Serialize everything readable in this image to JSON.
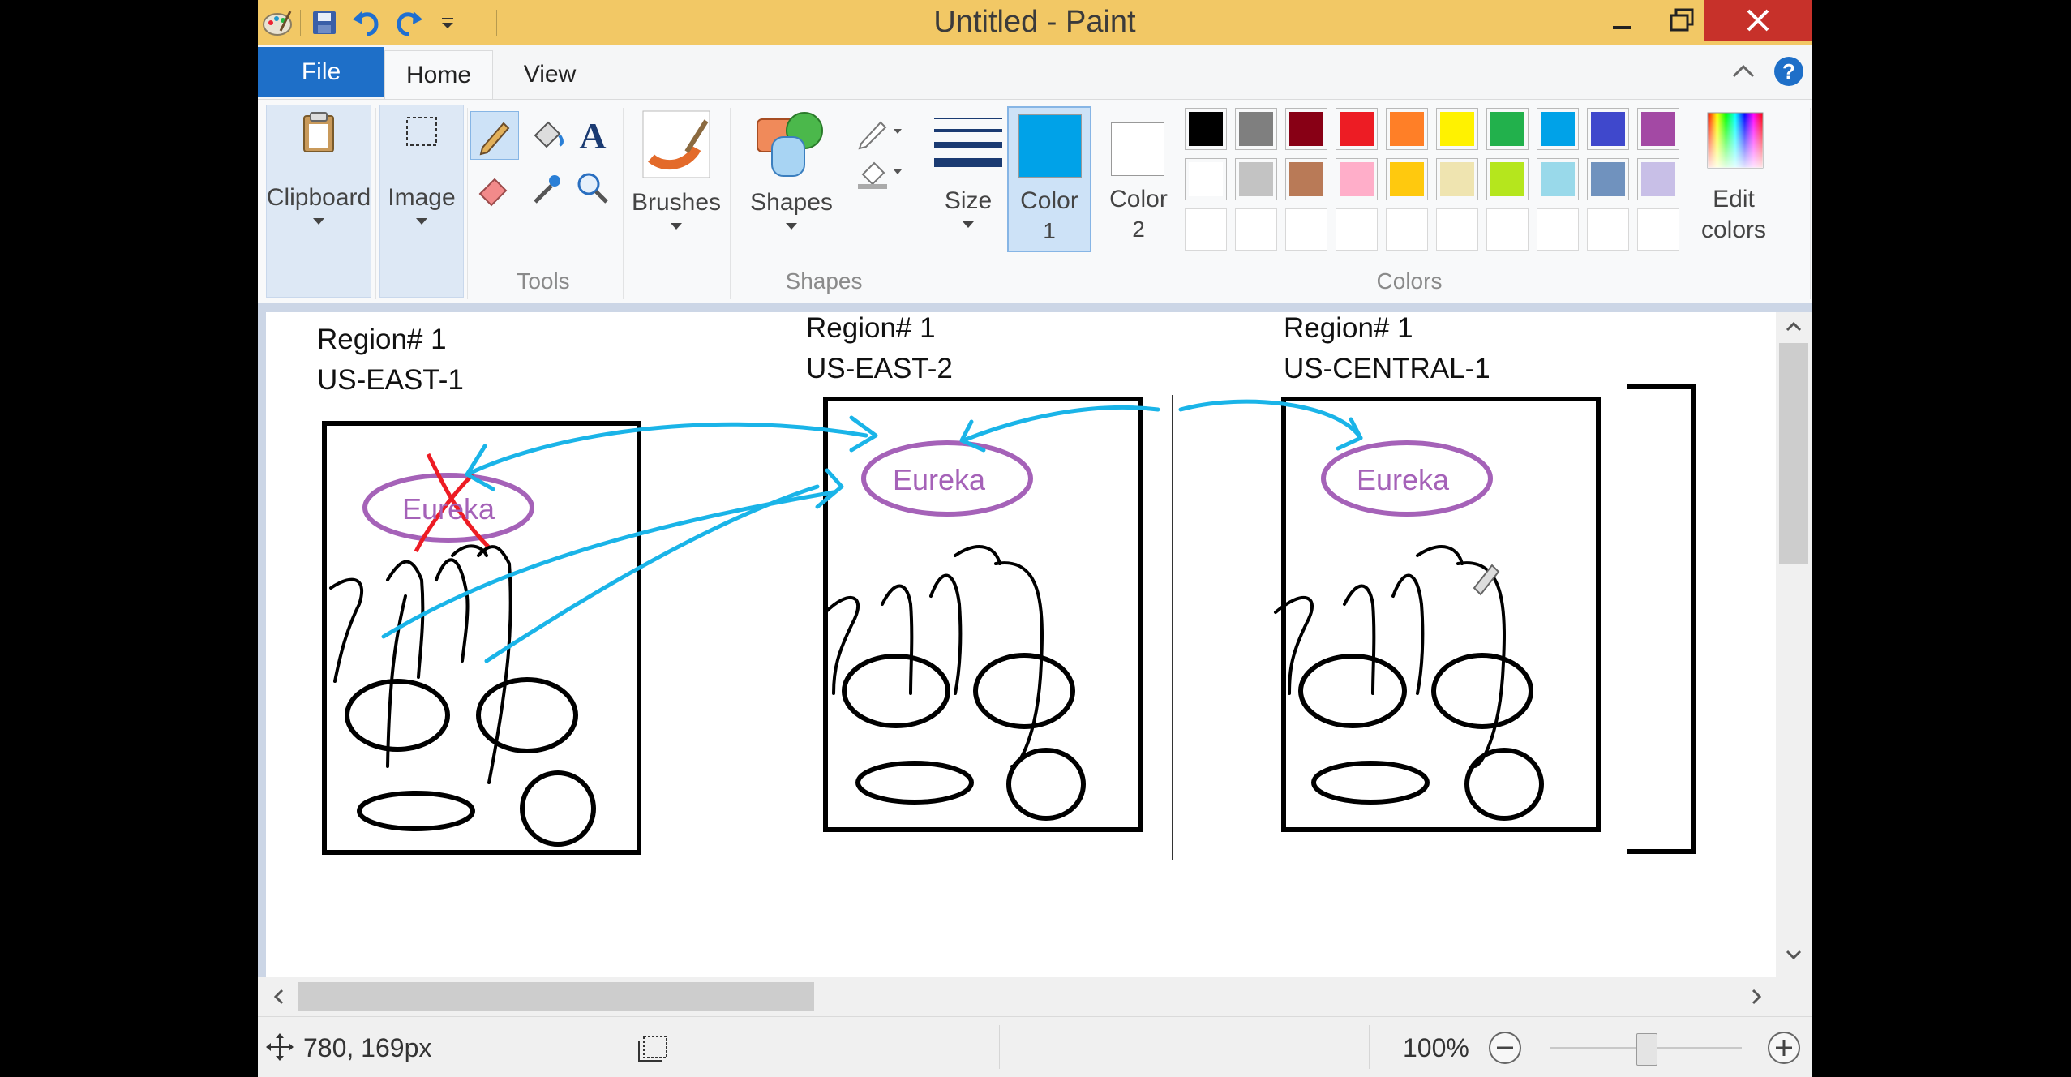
{
  "window": {
    "title": "Untitled - Paint"
  },
  "tabs": {
    "file": "File",
    "home": "Home",
    "view": "View"
  },
  "ribbon": {
    "clipboard": "Clipboard",
    "image": "Image",
    "tools": "Tools",
    "brushes": "Brushes",
    "shapes_btn": "Shapes",
    "shapes_group": "Shapes",
    "size": "Size",
    "color1": {
      "line1": "Color",
      "line2": "1",
      "value": "#00a2e8"
    },
    "color2": {
      "line1": "Color",
      "line2": "2",
      "value": "#ffffff"
    },
    "colors_group": "Colors",
    "edit_colors": {
      "line1": "Edit",
      "line2": "colors"
    },
    "palette_row1": [
      "#000000",
      "#7f7f7f",
      "#880015",
      "#ed1c24",
      "#ff7f27",
      "#fff200",
      "#22b14c",
      "#00a2e8",
      "#3f48cc",
      "#a349a4"
    ],
    "palette_row2": [
      "#ffffff",
      "#c3c3c3",
      "#b97a57",
      "#ffaec9",
      "#ffc90e",
      "#efe4b0",
      "#b5e61d",
      "#99d9ea",
      "#7092be",
      "#c8bfe7"
    ]
  },
  "canvas": {
    "region1": {
      "title": "Region# 1",
      "zone": "US-EAST-1",
      "label": "Eureka"
    },
    "region2": {
      "title": "Region# 1",
      "zone": "US-EAST-2",
      "label": "Eureka"
    },
    "region3": {
      "title": "Region# 1",
      "zone": "US-CENTRAL-1",
      "label": "Eureka"
    },
    "ink_color": "#000000",
    "arrow_color": "#1ab4e8",
    "cross_color": "#ed1c24",
    "eureka_color": "#a562b8"
  },
  "status": {
    "cursor_pos": "780, 169px",
    "zoom": "100%"
  }
}
